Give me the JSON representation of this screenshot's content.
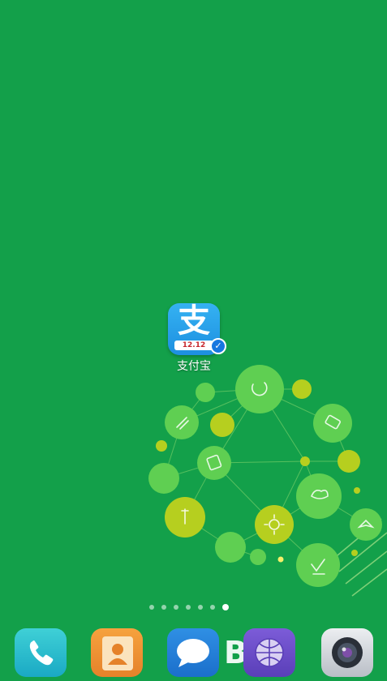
{
  "home_screen": {
    "app": {
      "label": "支付宝",
      "glyph": "支",
      "strip_text": "12.12",
      "icon": "alipay-icon",
      "badge_icon": "verified-shield-icon"
    },
    "page_indicator": {
      "total_pages": 7,
      "current_page": 7
    },
    "watermark": {
      "text": "Bai"
    }
  },
  "dock": {
    "apps": [
      {
        "name": "phone",
        "icon": "phone-icon"
      },
      {
        "name": "contacts",
        "icon": "contacts-icon"
      },
      {
        "name": "messages",
        "icon": "chat-bubble-icon"
      },
      {
        "name": "browser",
        "icon": "globe-icon"
      },
      {
        "name": "camera",
        "icon": "camera-icon"
      }
    ]
  },
  "colors": {
    "wallpaper": "#13a04a",
    "bubble_light": "#5fcf52",
    "bubble_yellow": "#b6cf1f",
    "alipay_blue": "#1d8fe0"
  }
}
